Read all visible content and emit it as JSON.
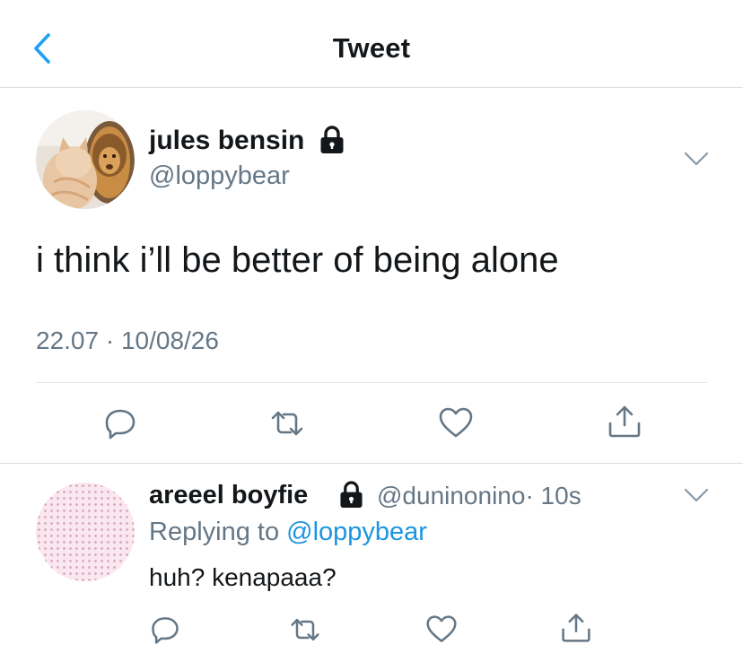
{
  "header": {
    "title": "Tweet",
    "back_icon": "chevron-left-icon",
    "accent_color": "#1da1f2"
  },
  "tweet": {
    "author_name": "jules bensin",
    "author_handle": "@loppybear",
    "protected_icon": "lock-icon",
    "text": "i think i’ll be better of being alone",
    "timestamp": "22.07 · 10/08/26",
    "actions": [
      "reply-icon",
      "retweet-icon",
      "like-icon",
      "share-icon"
    ]
  },
  "reply": {
    "author_name": "areeel boyfie",
    "author_handle": "@duninonino",
    "time_ago": "· 10s",
    "replying_prefix": "Replying to",
    "replying_mention": "@loppybear",
    "text": "huh? kenapaaa?",
    "actions": [
      "reply-icon",
      "retweet-icon",
      "like-icon",
      "share-icon"
    ]
  },
  "colors": {
    "text_primary": "#14171a",
    "text_secondary": "#657786",
    "link": "#1b95e0",
    "divider": "#d9dde1"
  }
}
